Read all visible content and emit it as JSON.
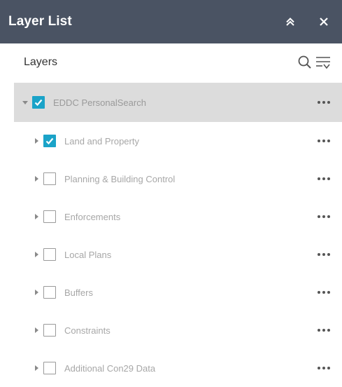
{
  "window": {
    "title": "Layer List"
  },
  "header": {
    "label": "Layers"
  },
  "colors": {
    "titlebar": "#4a5363",
    "checked": "#1aa3c8",
    "selected_row": "#dcdcdc"
  },
  "icons": {
    "collapse": "chevron-double-up-icon",
    "close": "close-icon",
    "search": "search-icon",
    "filter": "filter-list-icon",
    "more": "more-horizontal-icon"
  },
  "layers": [
    {
      "label": "EDDC PersonalSearch",
      "checked": true,
      "expanded": true,
      "level": 0
    },
    {
      "label": "Land and Property",
      "checked": true,
      "expanded": false,
      "level": 1
    },
    {
      "label": "Planning & Building Control",
      "checked": false,
      "expanded": false,
      "level": 1
    },
    {
      "label": "Enforcements",
      "checked": false,
      "expanded": false,
      "level": 1
    },
    {
      "label": "Local Plans",
      "checked": false,
      "expanded": false,
      "level": 1
    },
    {
      "label": "Buffers",
      "checked": false,
      "expanded": false,
      "level": 1
    },
    {
      "label": "Constraints",
      "checked": false,
      "expanded": false,
      "level": 1
    },
    {
      "label": "Additional Con29 Data",
      "checked": false,
      "expanded": false,
      "level": 1
    }
  ]
}
